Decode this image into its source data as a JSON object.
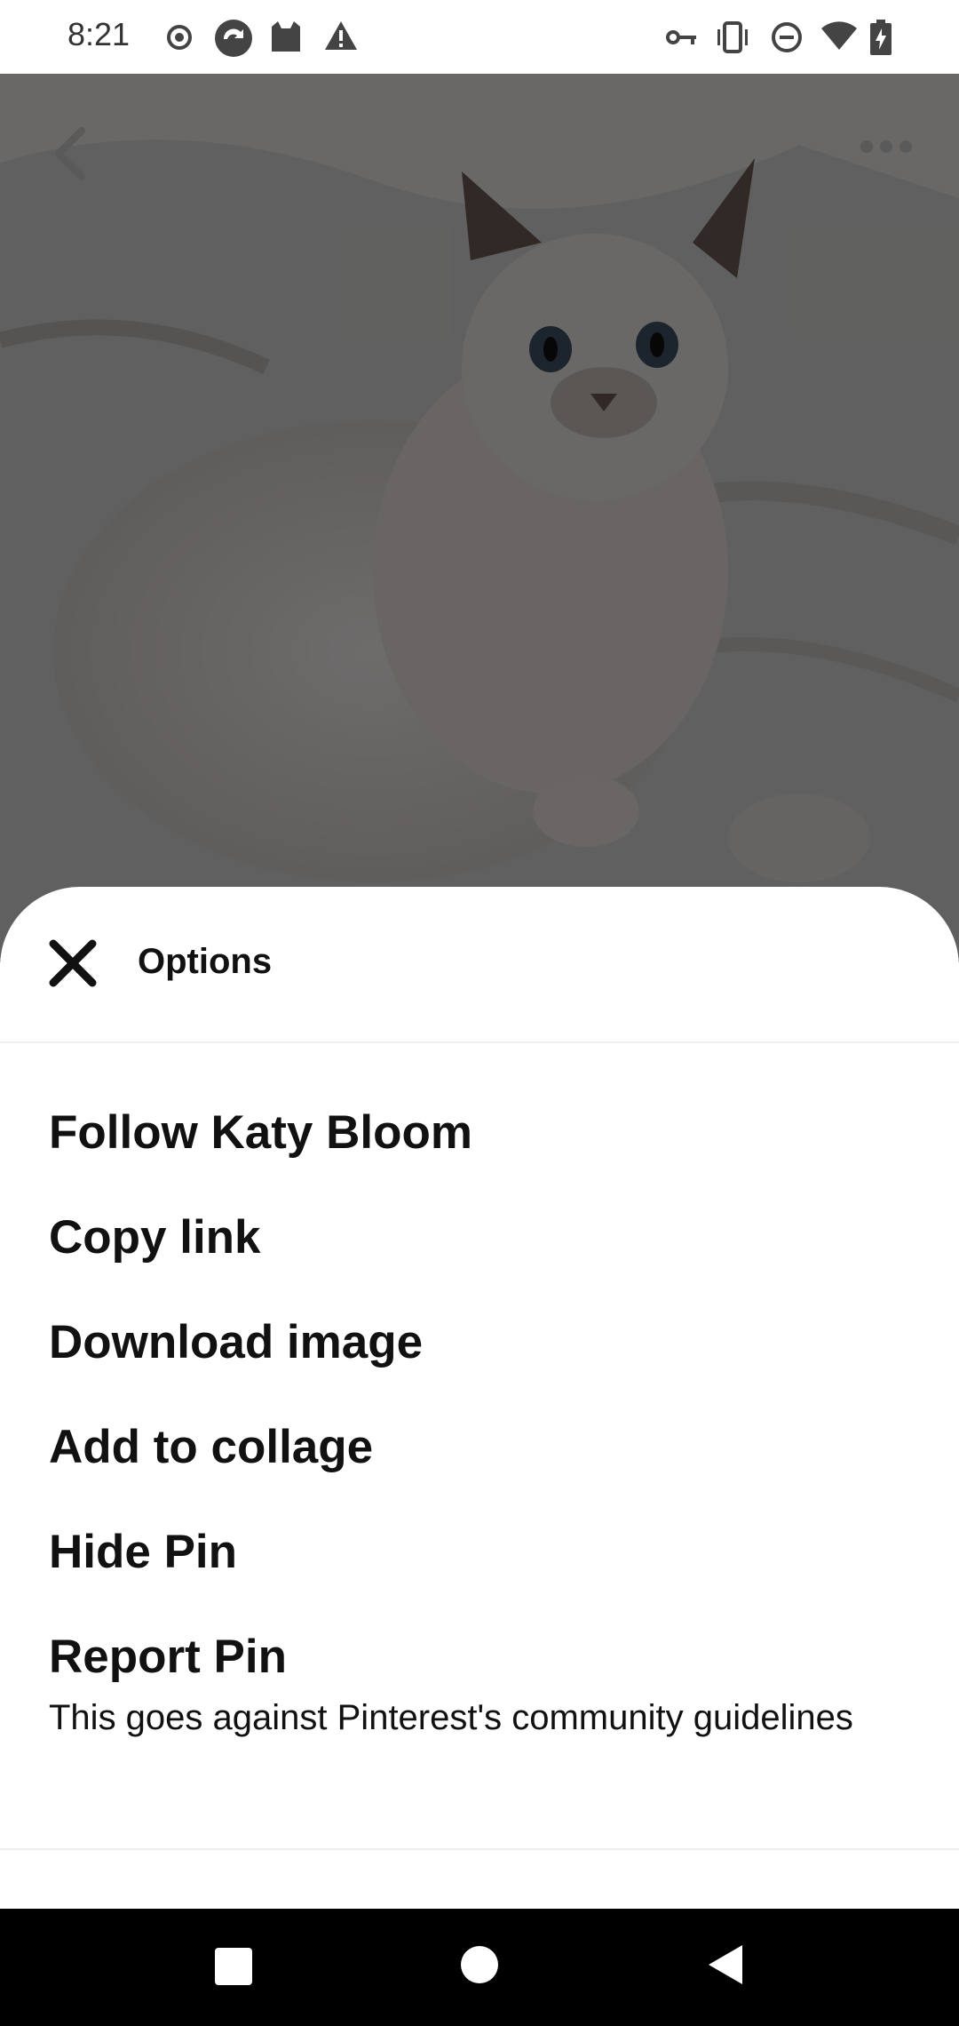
{
  "status_bar": {
    "time": "8:21",
    "left_icons": [
      "record-icon",
      "sync-icon",
      "cat-app-icon",
      "warning-icon"
    ],
    "right_icons": [
      "key-icon",
      "vibrate-icon",
      "do-not-disturb-icon",
      "wifi-icon",
      "battery-charging-icon"
    ]
  },
  "pin": {
    "image_description_icon": "cat-photo",
    "back_icon": "chevron-left-icon",
    "more_icon": "more-horizontal-icon"
  },
  "sheet": {
    "title": "Options",
    "close_icon": "close-icon",
    "items": [
      {
        "label": "Follow Katy Bloom"
      },
      {
        "label": "Copy link"
      },
      {
        "label": "Download image"
      },
      {
        "label": "Add to collage"
      },
      {
        "label": "Hide Pin"
      },
      {
        "label": "Report Pin",
        "sublabel": "This goes against Pinterest's community guidelines"
      }
    ]
  },
  "android_nav": {
    "buttons": [
      "recents-square-icon",
      "home-circle-icon",
      "back-triangle-icon"
    ]
  }
}
